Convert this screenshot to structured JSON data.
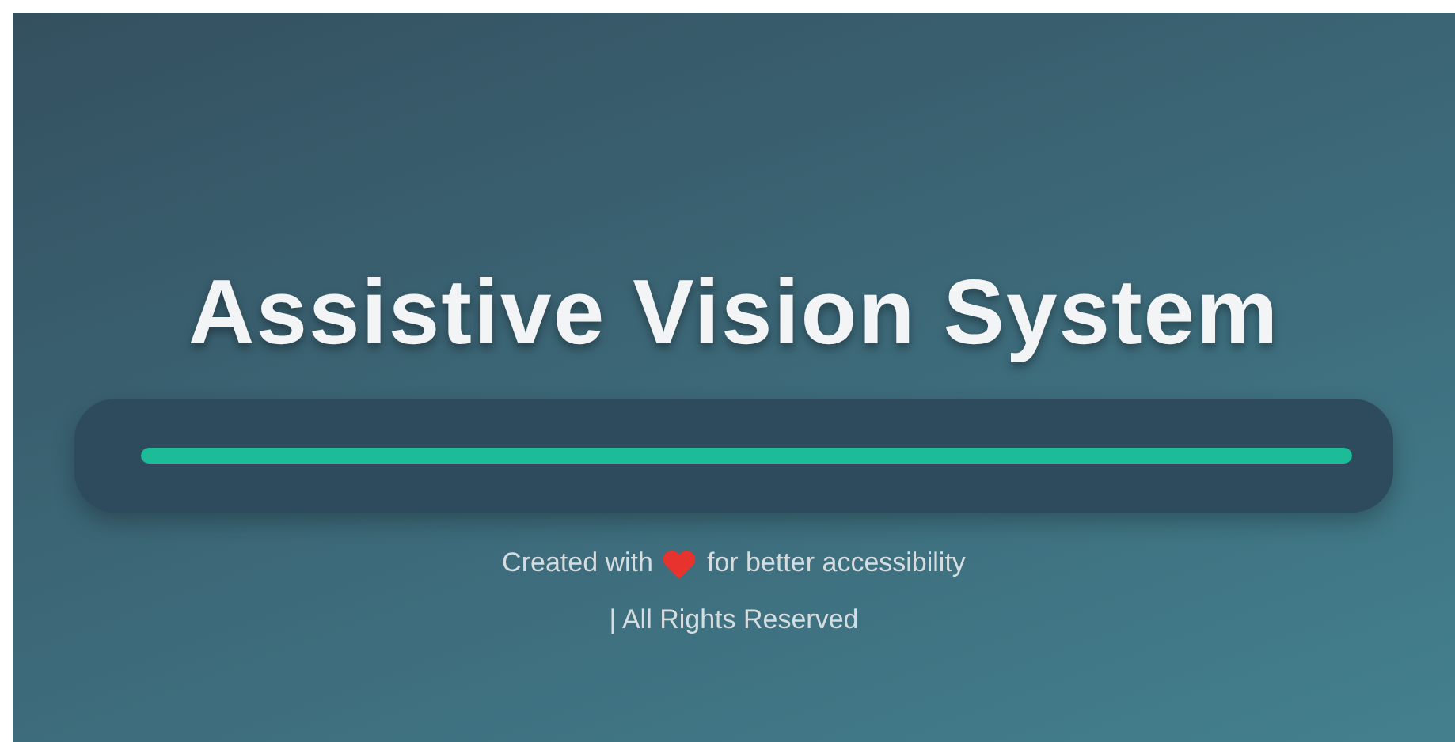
{
  "title": "Assistive Vision System",
  "footer": {
    "created_before": "Created with",
    "created_after": "for better accessibility",
    "rights": "| All Rights Reserved"
  }
}
